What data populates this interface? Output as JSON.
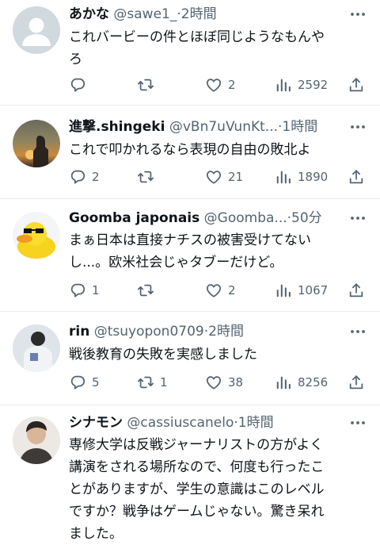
{
  "tweets": [
    {
      "name": "あかな",
      "handle": "@sawe1_",
      "separator": "·",
      "time": "2時間",
      "text_lines": [
        "これバービーの件とほぼ同じようなもんや",
        "ろ"
      ],
      "replies": "",
      "retweets": "",
      "likes": "2",
      "views": "2592"
    },
    {
      "name": "進撃.shingeki",
      "handle": "@vBn7uVunKt...",
      "separator": "·",
      "time": "1時間",
      "text_lines": [
        "これで叩かれるなら表現の自由の敗北よ"
      ],
      "replies": "2",
      "retweets": "",
      "likes": "21",
      "views": "1890"
    },
    {
      "name": "Goomba japonais",
      "handle": "@Goomba...",
      "separator": "·",
      "time": "50分",
      "text_lines": [
        "まぁ日本は直接ナチスの被害受けてない",
        "し...。欧米社会じゃタブーだけど。"
      ],
      "replies": "1",
      "retweets": "",
      "likes": "2",
      "views": "1067"
    },
    {
      "name": "rin",
      "handle": "@tsuyopon0709",
      "separator": "·",
      "time": "2時間",
      "text_lines": [
        "戦後教育の失敗を実感しました"
      ],
      "replies": "5",
      "retweets": "1",
      "likes": "38",
      "views": "8256"
    },
    {
      "name": "シナモン",
      "handle": "@cassiuscanelo",
      "separator": "·",
      "time": "1時間",
      "text_lines": [
        "専修大学は反戦ジャーナリストの方がよく",
        "講演をされる場所なので、何度も行ったこ",
        "とがありますが、学生の意識はこのレベル",
        "ですか？戦争はゲームじゃない。驚き呆れ",
        "ました。"
      ]
    }
  ],
  "colors": {
    "text": "#0f1419",
    "secondary": "#536471",
    "divider": "#e9ecef"
  },
  "icons": [
    "reply-icon",
    "retweet-icon",
    "like-icon",
    "views-icon",
    "share-icon",
    "more-icon"
  ]
}
